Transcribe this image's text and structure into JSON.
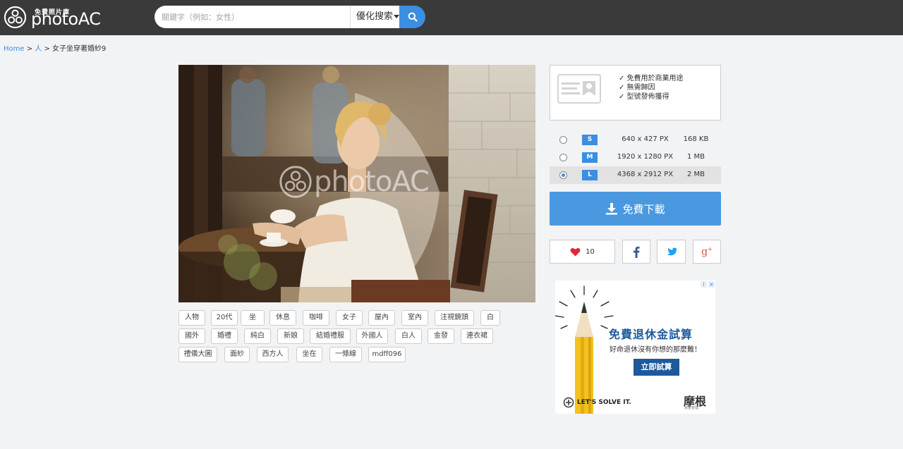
{
  "header": {
    "logo_small": "免費照片庫",
    "logo_big": "photoAC",
    "search_placeholder": "關鍵字（例如：女性）",
    "search_mode": "優化搜索"
  },
  "breadcrumb": {
    "home": "Home",
    "sep1": " > ",
    "category": "人",
    "sep2": " > ",
    "current": "女子坐穿著婚紗9"
  },
  "photo": {
    "watermark": "photoAC"
  },
  "tags": [
    "人物",
    "20代",
    "坐",
    "休息",
    "咖啡",
    "女子",
    "屋內",
    "室內",
    "注視鏡頭",
    "白",
    "國外",
    "婚禮",
    "純白",
    "新娘",
    "結婚禮服",
    "外國人",
    "白人",
    "金發",
    "連衣裙",
    "禮儀大圖",
    "面紗",
    "西方人",
    "坐在",
    "一條線",
    "mdff096"
  ],
  "license": {
    "items": [
      "✓ 免費用於商業用途",
      "✓ 無需歸因",
      "✓ 型號發佈獲得"
    ]
  },
  "sizes": [
    {
      "badge": "S",
      "dims": "640 x 427 PX",
      "file": "168 KB",
      "selected": false
    },
    {
      "badge": "M",
      "dims": "1920 x 1280 PX",
      "file": "1 MB",
      "selected": false
    },
    {
      "badge": "L",
      "dims": "4368 x 2912 PX",
      "file": "2 MB",
      "selected": true
    }
  ],
  "download": {
    "label": "免費下載"
  },
  "social": {
    "likes": "10"
  },
  "ad": {
    "title": "免費退休金試算",
    "subtitle": "好命退休沒有你想的那麼難！",
    "button": "立即試算",
    "slogan": "LET'S SOLVE IT.",
    "brand": "摩根",
    "brand_sub": "資產管理"
  },
  "colors": {
    "header_bg": "#3a3a3a",
    "accent": "#3b8ee0",
    "download_bg": "#4a99e0",
    "page_bg": "#f2f3f5",
    "heart": "#e0263a",
    "facebook": "#3b5998",
    "twitter": "#1da1f2",
    "google": "#dd4b39"
  }
}
